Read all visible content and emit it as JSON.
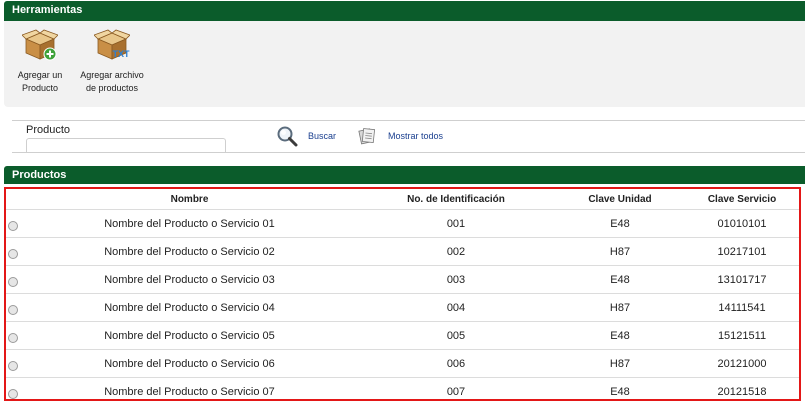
{
  "tools": {
    "title": "Herramientas",
    "items": [
      {
        "icon": "box-add-icon",
        "line1": "Agregar un",
        "line2": "Producto"
      },
      {
        "icon": "box-txt-icon",
        "line1": "Agregar archivo",
        "line2": "de productos",
        "badge": "TXT"
      }
    ]
  },
  "search": {
    "label": "Producto",
    "value": "",
    "placeholder": "",
    "search_label": "Buscar",
    "show_all_label": "Mostrar todos",
    "search_icon": "magnifier-icon",
    "show_all_icon": "documents-icon"
  },
  "products": {
    "title": "Productos",
    "columns": [
      "Nombre",
      "No. de Identificación",
      "Clave Unidad",
      "Clave Servicio"
    ],
    "rows": [
      {
        "nombre": "Nombre del Producto o Servicio 01",
        "id": "001",
        "unidad": "E48",
        "servicio": "01010101"
      },
      {
        "nombre": "Nombre del Producto o Servicio 02",
        "id": "002",
        "unidad": "H87",
        "servicio": "10217101"
      },
      {
        "nombre": "Nombre del Producto o Servicio 03",
        "id": "003",
        "unidad": "E48",
        "servicio": "13101717"
      },
      {
        "nombre": "Nombre del Producto o Servicio 04",
        "id": "004",
        "unidad": "H87",
        "servicio": "14111541"
      },
      {
        "nombre": "Nombre del Producto o Servicio 05",
        "id": "005",
        "unidad": "E48",
        "servicio": "15121511"
      },
      {
        "nombre": "Nombre del Producto o Servicio 06",
        "id": "006",
        "unidad": "H87",
        "servicio": "20121000"
      },
      {
        "nombre": "Nombre del Producto o Servicio 07",
        "id": "007",
        "unidad": "E48",
        "servicio": "20121518"
      }
    ]
  },
  "colors": {
    "header_green": "#0b5c2b",
    "highlight_red": "#e31717",
    "link_blue": "#1a3f8f",
    "toolbar_bg": "#f2f2f2"
  }
}
